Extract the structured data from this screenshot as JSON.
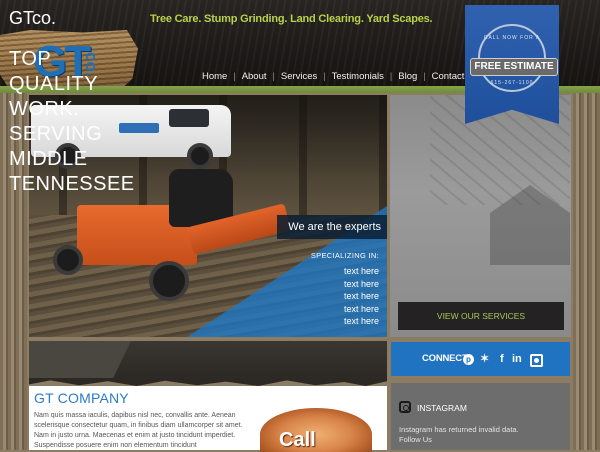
{
  "brand": {
    "logo_main": "GT",
    "logo_sub": "co."
  },
  "nav": {
    "items": [
      "Home",
      "About",
      "Services",
      "Testimonials",
      "Blog",
      "Contact"
    ]
  },
  "ribbon": {
    "top": "CALL NOW FOR A",
    "label": "FREE ESTIMATE",
    "phone": "615-267-1100"
  },
  "hero": {
    "experts": "We are the experts",
    "specializing": "SPECIALIZING IN:",
    "list": [
      "text here",
      "text here",
      "text here",
      "text here",
      "text here"
    ]
  },
  "quality": {
    "lines": [
      "TOP",
      "QUALITY",
      "WORK.",
      "SERVING",
      "MIDDLE",
      "TENNESSEE"
    ],
    "button": "VIEW OUR SERVICES"
  },
  "gtco": {
    "title": "GTco.",
    "services": "Tree Care. Stump Grinding. Land Clearing. Yard Scapes."
  },
  "connect": {
    "label": "CONNECT",
    "icons": [
      "pinterest-icon",
      "twitter-icon",
      "facebook-icon",
      "linkedin-icon",
      "instagram-icon"
    ]
  },
  "company": {
    "title": "GT COMPANY",
    "body": "Nam quis massa iaculis, dapibus nisl nec, convallis ante. Aenean scelerisque consectetur quam, in finibus diam ullamcorper sit amet. Nam in justo urna. Maecenas et enim at justo tincidunt imperdiet. Suspendisse posuere enim non elementum tincidunt",
    "call": "Call"
  },
  "instagram": {
    "title": "INSTAGRAM",
    "message": "Instagram has returned invalid data.",
    "follow": "Follow Us"
  },
  "colors": {
    "accent_blue": "#1f73c0",
    "green": "#b7d24a",
    "orange": "#e86a2e"
  }
}
